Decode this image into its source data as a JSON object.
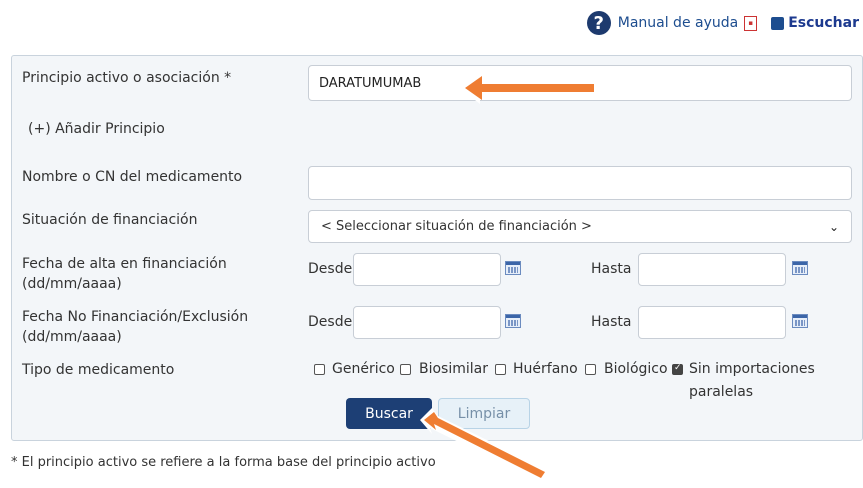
{
  "toolbar": {
    "manual_label": "Manual de ayuda",
    "listen_label": "Escuchar",
    "help_glyph": "?"
  },
  "form": {
    "principio_label": "Principio activo o asociación *",
    "principio_value": "DARATUMUMAB",
    "add_principio": "(+) Añadir Principio",
    "nombre_label": "Nombre o CN del medicamento",
    "nombre_value": "",
    "financiacion_label": "Situación de financiación",
    "financiacion_selected": "< Seleccionar situación de financiación >",
    "alta_label_1": "Fecha de alta en financiación",
    "alta_label_2": "(dd/mm/aaaa)",
    "exclusion_label_1": "Fecha No Financiación/Exclusión",
    "exclusion_label_2": "(dd/mm/aaaa)",
    "desde": "Desde",
    "hasta": "Hasta",
    "tipo_label": "Tipo de medicamento",
    "tipos": [
      {
        "label": "Genérico",
        "checked": false
      },
      {
        "label": "Biosimilar",
        "checked": false
      },
      {
        "label": "Huérfano",
        "checked": false
      },
      {
        "label": "Biológico",
        "checked": false
      },
      {
        "label": "Sin importaciones",
        "label2": "paralelas",
        "checked": true
      }
    ],
    "buscar": "Buscar",
    "limpiar": "Limpiar"
  },
  "footnote": "* El principio activo se refiere a la forma base del principio activo",
  "colors": {
    "primary": "#1d3f75",
    "arrow": "#ef7d32",
    "panel": "#f3f6f9"
  }
}
